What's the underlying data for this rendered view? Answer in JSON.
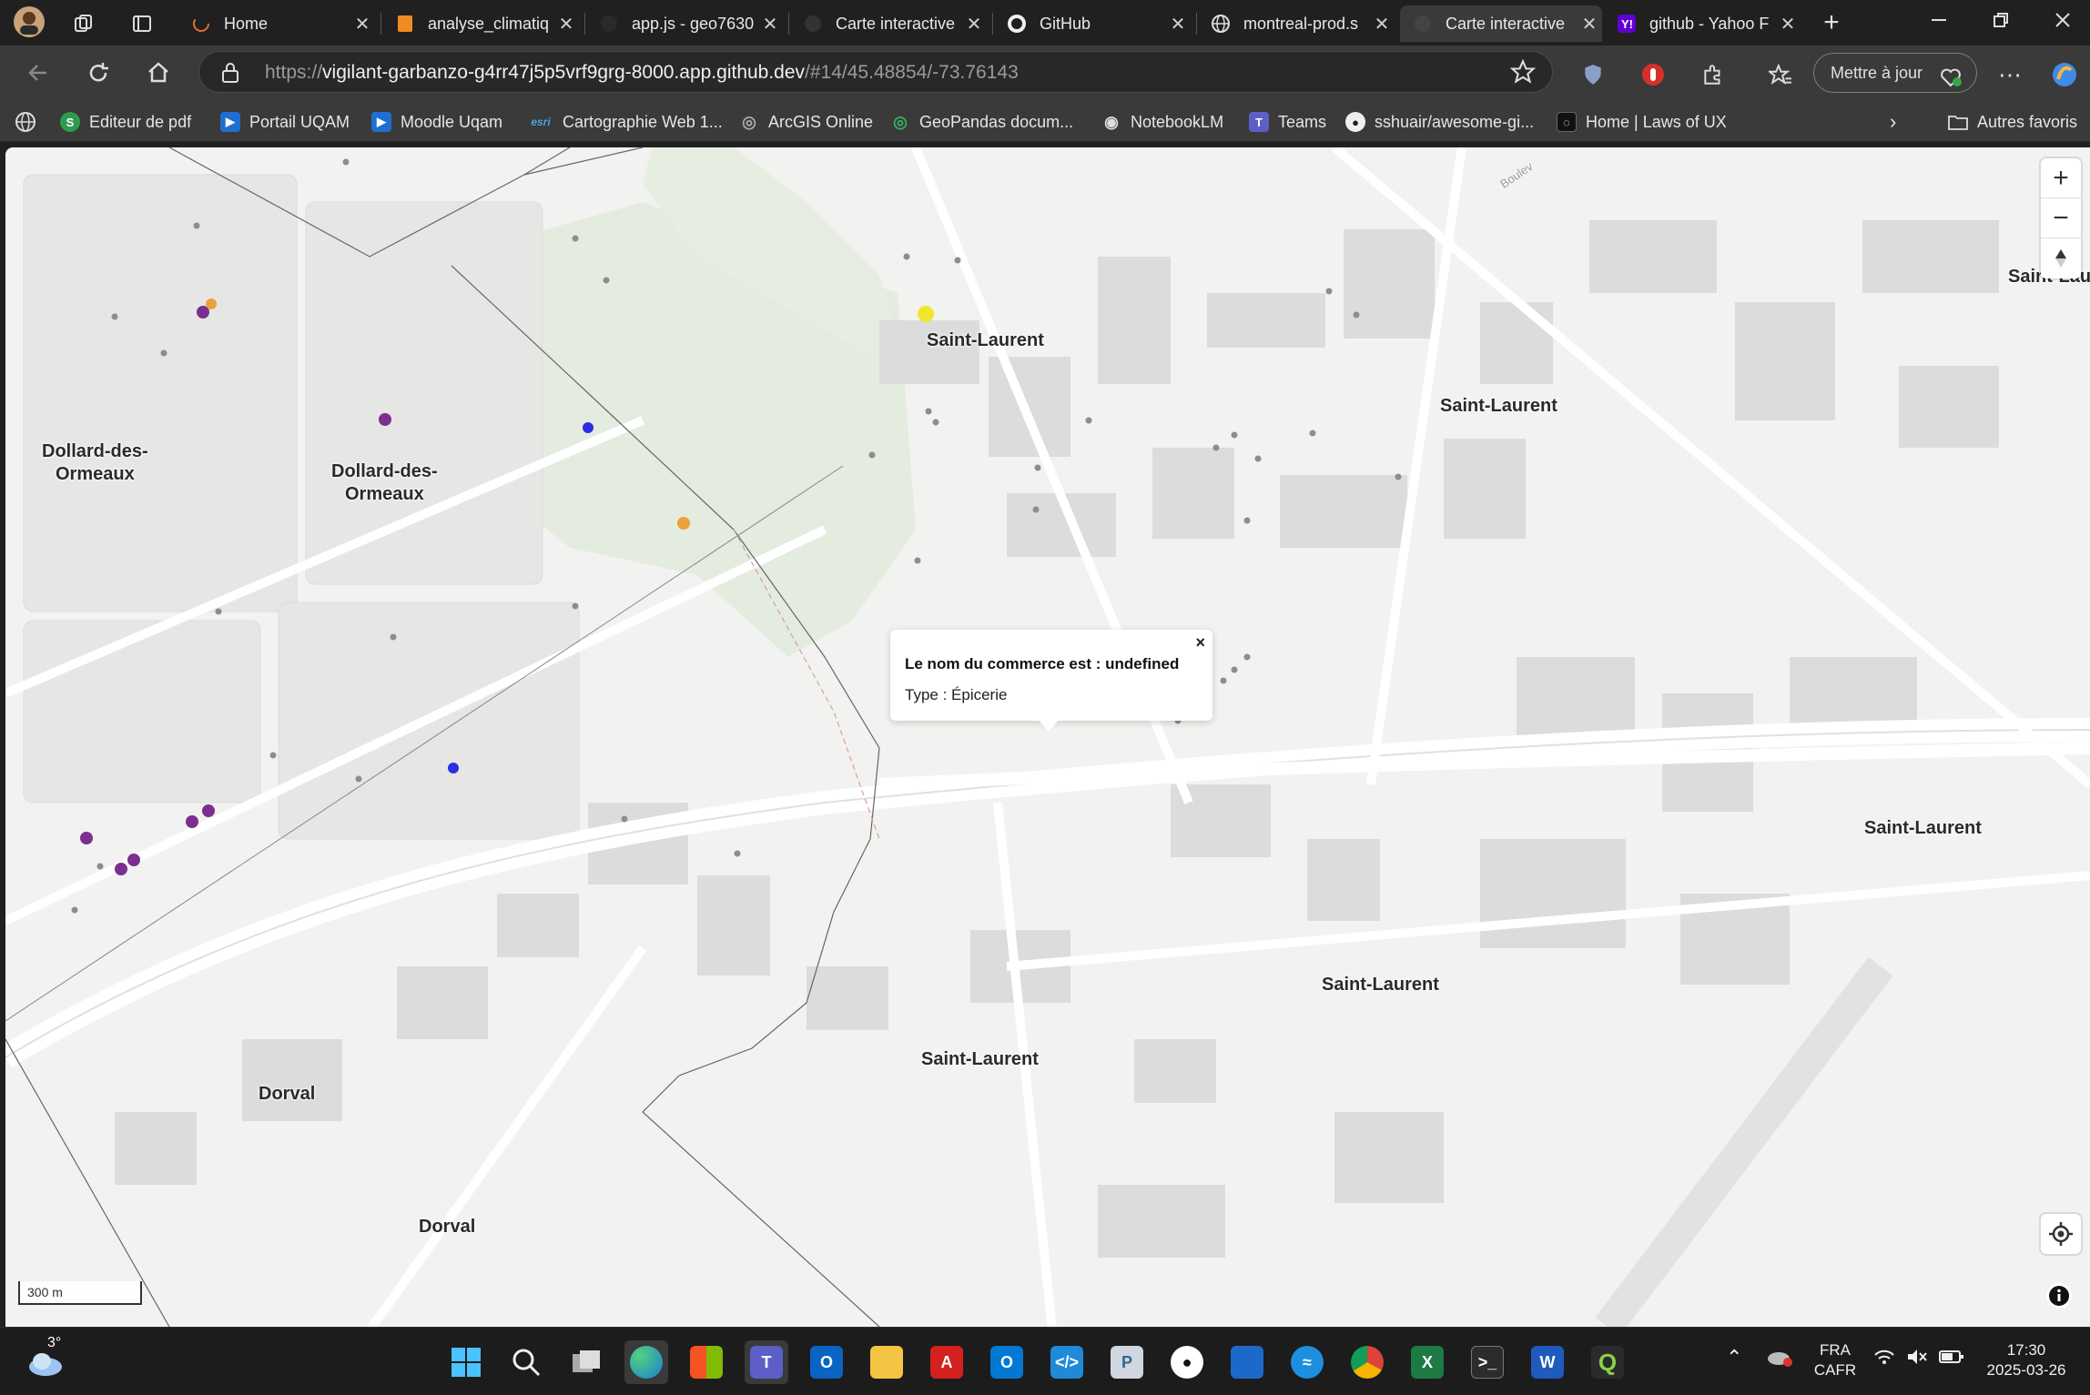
{
  "browser": {
    "tabs": [
      {
        "label": "Home",
        "icon": "loading-spinner-icon"
      },
      {
        "label": "analyse_climatiq",
        "icon": "notebook-icon"
      },
      {
        "label": "app.js - geo7630",
        "icon": "codespace-icon"
      },
      {
        "label": "Carte interactive",
        "icon": "github-icon"
      },
      {
        "label": "GitHub",
        "icon": "github-icon"
      },
      {
        "label": "montreal-prod.s",
        "icon": "globe-icon"
      },
      {
        "label": "Carte interactive",
        "icon": "github-icon",
        "active": true
      },
      {
        "label": "github - Yahoo F",
        "icon": "yahoo-icon"
      }
    ],
    "close_glyph": "✕",
    "new_tab_glyph": "+",
    "url": {
      "scheme": "https://",
      "host": "vigilant-garbanzo-g4rr47j5p5vrf9grg-8000.app.github.dev",
      "fragment": "/#14/45.48854/-73.76143"
    },
    "update_button": "Mettre à jour",
    "bookmarks": [
      {
        "label": "Editeur de pdf",
        "icon": "S",
        "color": "#2e9b4f"
      },
      {
        "label": "Portail UQAM",
        "icon": "▶",
        "color": "#1f6fd0"
      },
      {
        "label": "Moodle Uqam",
        "icon": "▶",
        "color": "#1f6fd0"
      },
      {
        "label": "Cartographie Web 1...",
        "icon": "esri",
        "color": "#3a3a3a"
      },
      {
        "label": "ArcGIS Online",
        "icon": "◎",
        "color": "#3a3a3a"
      },
      {
        "label": "GeoPandas docum...",
        "icon": "◎",
        "color": "#1c8a3c"
      },
      {
        "label": "NotebookLM",
        "icon": "◉",
        "color": "#3a3a3a"
      },
      {
        "label": "Teams",
        "icon": "T",
        "color": "#5b5fc7"
      },
      {
        "label": "sshuair/awesome-gi...",
        "icon": "●",
        "color": "#3a3a3a"
      },
      {
        "label": "Home | Laws of UX",
        "icon": "◌",
        "color": "#111111"
      }
    ],
    "other_bookmarks": "Autres favoris"
  },
  "map": {
    "place_labels": [
      {
        "text": "Saint-Laurent"
      },
      {
        "text": "Saint-Laurent"
      },
      {
        "text": "Saint-Lau"
      },
      {
        "text": "Dollard-des-\nOrmeaux"
      },
      {
        "text": "Dollard-des-\nOrmeaux"
      },
      {
        "text": "Saint-Laurent"
      },
      {
        "text": "Saint-Laurent"
      },
      {
        "text": "Saint-Laurent"
      },
      {
        "text": "Dorval"
      },
      {
        "text": "Dorval"
      },
      {
        "text": "Boulev"
      }
    ],
    "popup": {
      "title": "Le nom du commerce est : undefined",
      "type": "Type : Épicerie",
      "close": "×"
    },
    "scale_label": "300 m",
    "zoom_in": "+",
    "zoom_out": "−",
    "marker_colors": {
      "purple": "#7b2f8e",
      "orange": "#e8a33a",
      "yellow": "#f0e62e",
      "blue": "#2a2fe0"
    }
  },
  "taskbar": {
    "weather": "3°",
    "lang_top": "FRA",
    "lang_bottom": "CAFR",
    "time": "17:30",
    "date": "2025-03-26"
  }
}
